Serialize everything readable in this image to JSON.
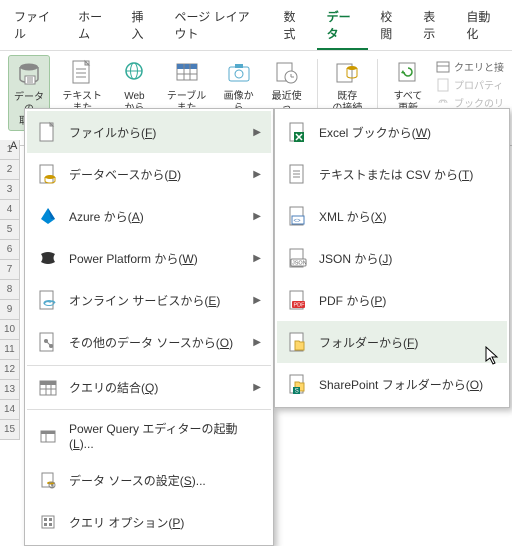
{
  "tabs": [
    "ファイル",
    "ホーム",
    "挿入",
    "ページ レイアウト",
    "数式",
    "データ",
    "校閲",
    "表示",
    "自動化"
  ],
  "activeTab": 5,
  "ribbon": {
    "getData": "データの\n取得",
    "textCsv": "テキストまた\nは CSV から",
    "web": "Web\nから",
    "tableRange": "テーブルまた\nは範囲から",
    "picture": "画像か\nら",
    "recent": "最近使っ\nたソース",
    "existing": "既存\nの接続",
    "refresh": "すべて\n更新",
    "side1": "クエリと接",
    "side2": "プロパティ",
    "side3": "ブックのリ"
  },
  "menu1": [
    {
      "label": "ファイルから(F)",
      "arrow": true,
      "hl": true
    },
    {
      "label": "データベースから(D)",
      "arrow": true
    },
    {
      "label": "Azure から(A)",
      "arrow": true
    },
    {
      "label": "Power Platform から(W)",
      "arrow": true
    },
    {
      "label": "オンライン サービスから(E)",
      "arrow": true
    },
    {
      "label": "その他のデータ ソースから(O)",
      "arrow": true
    },
    {
      "label": "クエリの結合(Q)",
      "arrow": true,
      "sep": true
    },
    {
      "label": "Power Query エディターの起動(L)...",
      "arrow": false,
      "sep": true
    },
    {
      "label": "データ ソースの設定(S)...",
      "arrow": false
    },
    {
      "label": "クエリ オプション(P)",
      "arrow": false
    }
  ],
  "menu2": [
    {
      "label": "Excel ブックから(W)"
    },
    {
      "label": "テキストまたは CSV から(T)"
    },
    {
      "label": "XML から(X)"
    },
    {
      "label": "JSON から(J)"
    },
    {
      "label": "PDF から(P)"
    },
    {
      "label": "フォルダーから(F)",
      "hl": true
    },
    {
      "label": "SharePoint フォルダーから(O)"
    }
  ],
  "rows": [
    1,
    2,
    3,
    4,
    5,
    6,
    7,
    8,
    9,
    10,
    11,
    12,
    13,
    14,
    15
  ],
  "cellA1": "A"
}
